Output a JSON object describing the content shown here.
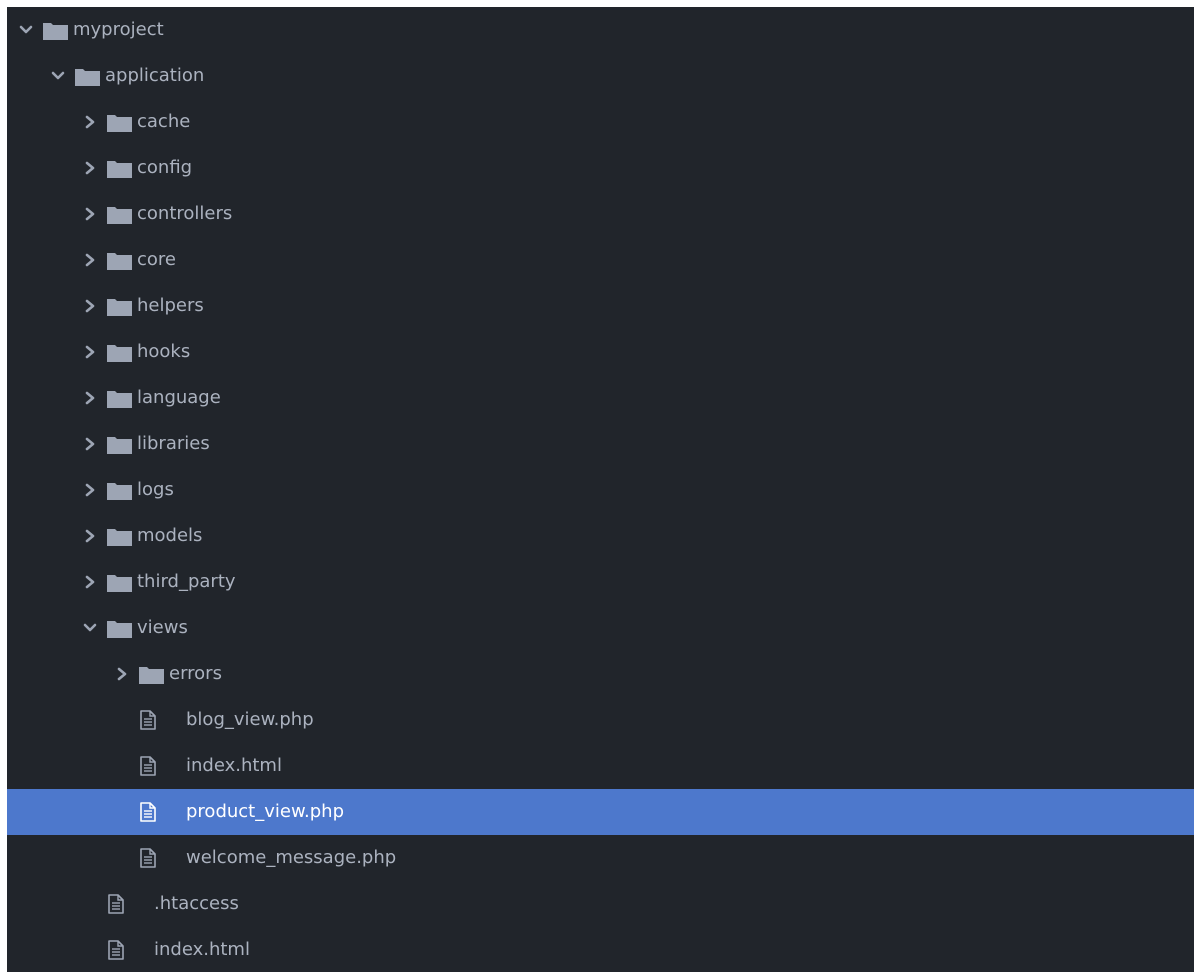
{
  "colors": {
    "panel_bg": "#21252b",
    "text": "#abb2bf",
    "icon": "#9da5b4",
    "selection": "#4d78cc",
    "selected_text": "#ffffff"
  },
  "tree": {
    "items": [
      {
        "label": "myproject",
        "type": "folder",
        "expanded": true,
        "depth": 0
      },
      {
        "label": "application",
        "type": "folder",
        "expanded": true,
        "depth": 1
      },
      {
        "label": "cache",
        "type": "folder",
        "expanded": false,
        "depth": 2
      },
      {
        "label": "config",
        "type": "folder",
        "expanded": false,
        "depth": 2
      },
      {
        "label": "controllers",
        "type": "folder",
        "expanded": false,
        "depth": 2
      },
      {
        "label": "core",
        "type": "folder",
        "expanded": false,
        "depth": 2
      },
      {
        "label": "helpers",
        "type": "folder",
        "expanded": false,
        "depth": 2
      },
      {
        "label": "hooks",
        "type": "folder",
        "expanded": false,
        "depth": 2
      },
      {
        "label": "language",
        "type": "folder",
        "expanded": false,
        "depth": 2
      },
      {
        "label": "libraries",
        "type": "folder",
        "expanded": false,
        "depth": 2
      },
      {
        "label": "logs",
        "type": "folder",
        "expanded": false,
        "depth": 2
      },
      {
        "label": "models",
        "type": "folder",
        "expanded": false,
        "depth": 2
      },
      {
        "label": "third_party",
        "type": "folder",
        "expanded": false,
        "depth": 2
      },
      {
        "label": "views",
        "type": "folder",
        "expanded": true,
        "depth": 2
      },
      {
        "label": "errors",
        "type": "folder",
        "expanded": false,
        "depth": 3
      },
      {
        "label": "blog_view.php",
        "type": "file",
        "depth": 3
      },
      {
        "label": "index.html",
        "type": "file",
        "depth": 3
      },
      {
        "label": "product_view.php",
        "type": "file",
        "depth": 3,
        "selected": true
      },
      {
        "label": "welcome_message.php",
        "type": "file",
        "depth": 3
      },
      {
        "label": ".htaccess",
        "type": "file",
        "depth": 2
      },
      {
        "label": "index.html",
        "type": "file",
        "depth": 2
      }
    ]
  }
}
